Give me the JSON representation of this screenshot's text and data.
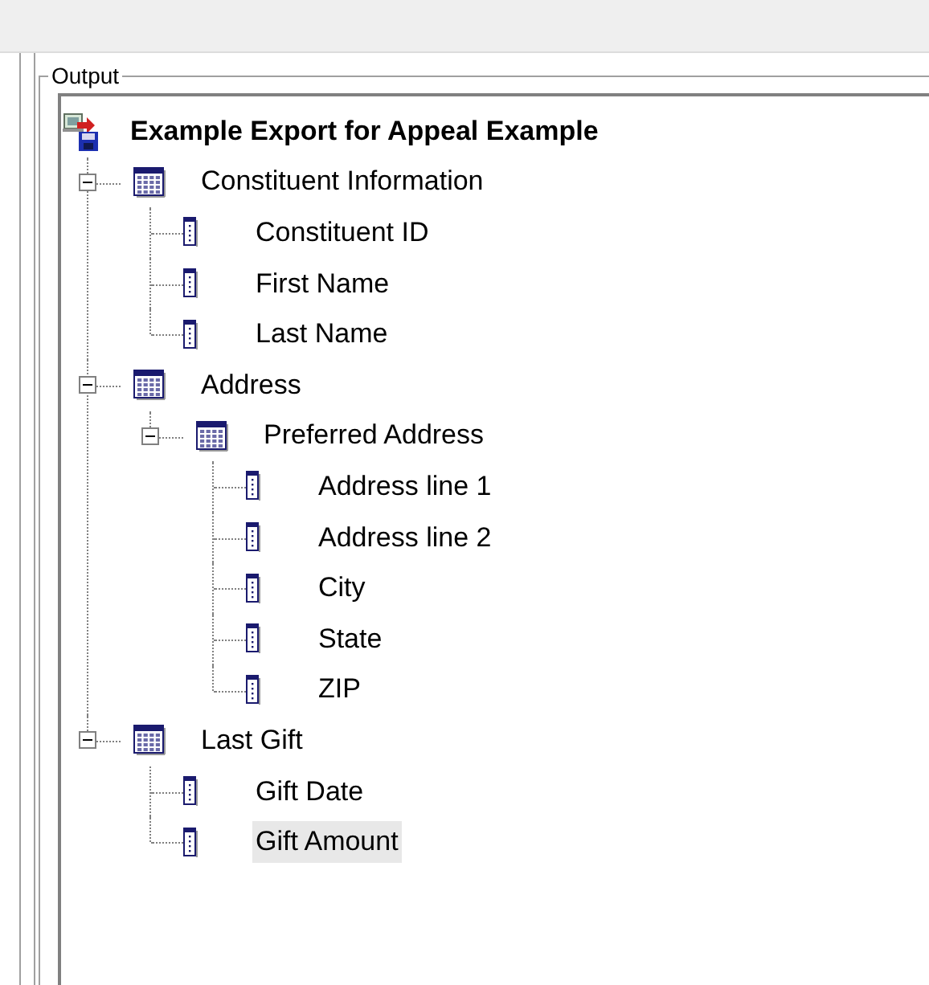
{
  "group_box": {
    "label": "Output"
  },
  "tree": {
    "root": {
      "label": "Example Export for Appeal Example",
      "children": [
        {
          "kind": "group",
          "label": "Constituent Information",
          "expanded": true,
          "selected": false,
          "children": [
            {
              "kind": "field",
              "label": "Constituent ID",
              "selected": false
            },
            {
              "kind": "field",
              "label": "First Name",
              "selected": false
            },
            {
              "kind": "field",
              "label": "Last Name",
              "selected": false
            }
          ]
        },
        {
          "kind": "group",
          "label": "Address",
          "expanded": true,
          "selected": false,
          "children": [
            {
              "kind": "group",
              "label": "Preferred Address",
              "expanded": true,
              "selected": false,
              "children": [
                {
                  "kind": "field",
                  "label": "Address line 1",
                  "selected": false
                },
                {
                  "kind": "field",
                  "label": "Address line 2",
                  "selected": false
                },
                {
                  "kind": "field",
                  "label": "City",
                  "selected": false
                },
                {
                  "kind": "field",
                  "label": "State",
                  "selected": false
                },
                {
                  "kind": "field",
                  "label": "ZIP",
                  "selected": false
                }
              ]
            }
          ]
        },
        {
          "kind": "group",
          "label": "Last Gift",
          "expanded": true,
          "selected": false,
          "children": [
            {
              "kind": "field",
              "label": "Gift Date",
              "selected": false
            },
            {
              "kind": "field",
              "label": "Gift Amount",
              "selected": true
            }
          ]
        }
      ]
    }
  }
}
